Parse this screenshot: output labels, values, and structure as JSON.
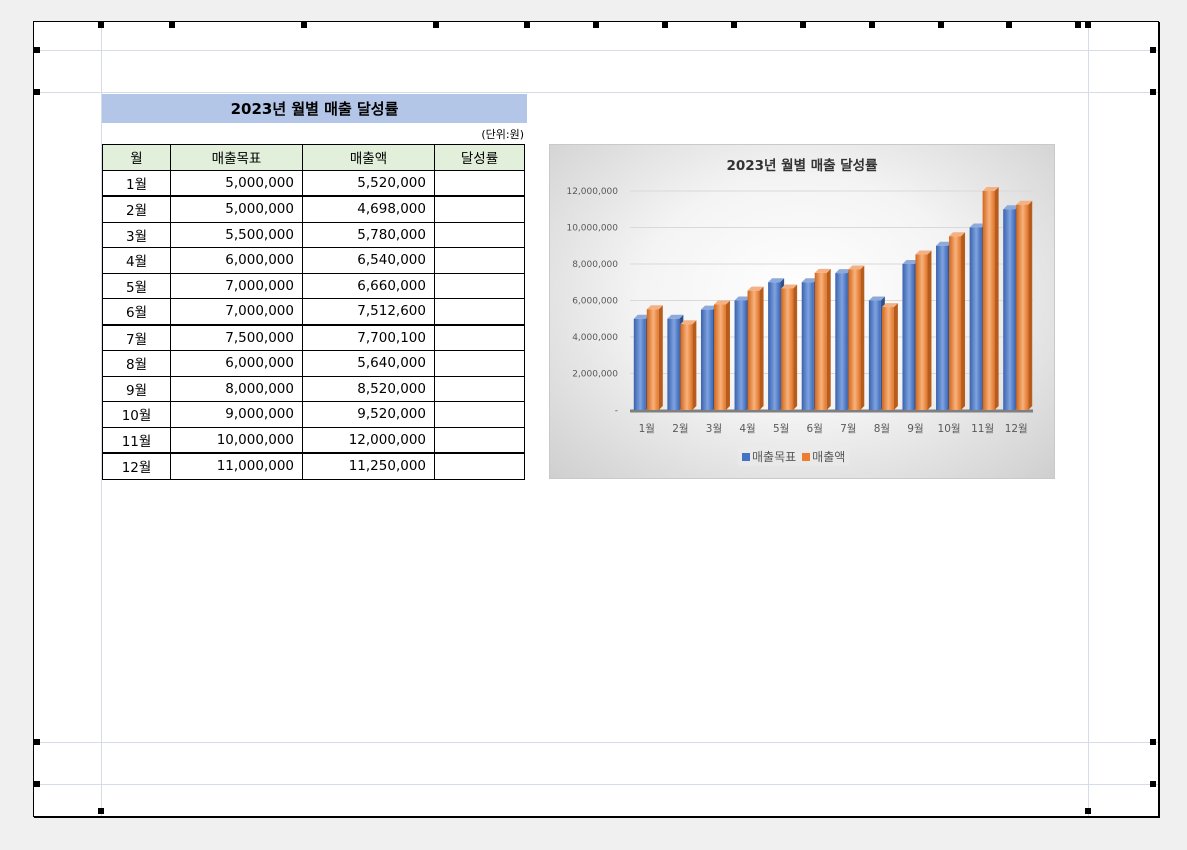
{
  "sheet": {
    "title": "2023년 월별 매출 달성률",
    "unit_label": "(단위:원)",
    "columns": [
      "월",
      "매출목표",
      "매출액",
      "달성률"
    ],
    "rows": [
      {
        "month": "1월",
        "target": "5,000,000",
        "sales": "5,520,000",
        "rate": ""
      },
      {
        "month": "2월",
        "target": "5,000,000",
        "sales": "4,698,000",
        "rate": ""
      },
      {
        "month": "3월",
        "target": "5,500,000",
        "sales": "5,780,000",
        "rate": ""
      },
      {
        "month": "4월",
        "target": "6,000,000",
        "sales": "6,540,000",
        "rate": ""
      },
      {
        "month": "5월",
        "target": "7,000,000",
        "sales": "6,660,000",
        "rate": ""
      },
      {
        "month": "6월",
        "target": "7,000,000",
        "sales": "7,512,600",
        "rate": ""
      },
      {
        "month": "7월",
        "target": "7,500,000",
        "sales": "7,700,100",
        "rate": ""
      },
      {
        "month": "8월",
        "target": "6,000,000",
        "sales": "5,640,000",
        "rate": ""
      },
      {
        "month": "9월",
        "target": "8,000,000",
        "sales": "8,520,000",
        "rate": ""
      },
      {
        "month": "10월",
        "target": "9,000,000",
        "sales": "9,520,000",
        "rate": ""
      },
      {
        "month": "11월",
        "target": "10,000,000",
        "sales": "12,000,000",
        "rate": ""
      },
      {
        "month": "12월",
        "target": "11,000,000",
        "sales": "11,250,000",
        "rate": ""
      }
    ]
  },
  "chart_data": {
    "type": "bar",
    "title": "2023년 월별 매출 달성률",
    "categories": [
      "1월",
      "2월",
      "3월",
      "4월",
      "5월",
      "6월",
      "7월",
      "8월",
      "9월",
      "10월",
      "11월",
      "12월"
    ],
    "series": [
      {
        "name": "매출목표",
        "color": "#4472c4",
        "values": [
          5000000,
          5000000,
          5500000,
          6000000,
          7000000,
          7000000,
          7500000,
          6000000,
          8000000,
          9000000,
          10000000,
          11000000
        ]
      },
      {
        "name": "매출액",
        "color": "#ed7d31",
        "values": [
          5520000,
          4698000,
          5780000,
          6540000,
          6660000,
          7512600,
          7700100,
          5640000,
          8520000,
          9520000,
          12000000,
          11250000
        ]
      }
    ],
    "ylim": [
      0,
      12000000
    ],
    "yticks": [
      "-",
      "2,000,000",
      "4,000,000",
      "6,000,000",
      "8,000,000",
      "10,000,000",
      "12,000,000"
    ],
    "ytick_values": [
      0,
      2000000,
      4000000,
      6000000,
      8000000,
      10000000,
      12000000
    ],
    "legend_position": "bottom",
    "grid": true
  }
}
